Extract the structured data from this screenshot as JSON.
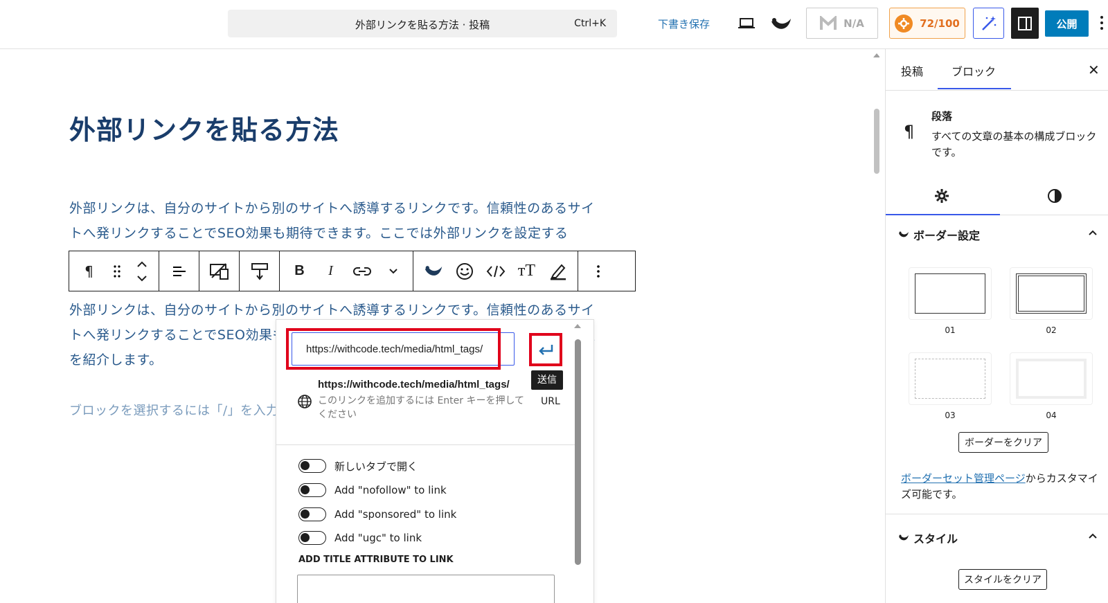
{
  "topbar": {
    "command_title": "外部リンクを貼る方法 · 投稿",
    "shortcut": "Ctrl+K",
    "save_draft": "下書き保存",
    "na_label": "N/A",
    "score": "72/100",
    "publish": "公開"
  },
  "editor": {
    "title": "外部リンクを貼る方法",
    "paragraph1": "外部リンクは、自分のサイトから別のサイトへ誘導するリンクです。信頼性のあるサイトへ発リンクすることでSEO効果も期待できます。ここでは外部リンクを設定する",
    "paragraph2": "外部リンクは、自分のサイトから別のサイトへ誘導するリンクです。信頼性のあるサイトへ発リンクすることでSEO効果も期待できます。ここでは外部リンクを設定する手順を紹介します。",
    "placeholder": "ブロックを選択するには「/」を入力"
  },
  "link_popover": {
    "url_value": "https://withcode.tech/media/html_tags/",
    "tooltip": "送信",
    "suggestion_url": "https://withcode.tech/media/html_tags/",
    "suggestion_hint": "このリンクを追加するには Enter キーを押してください",
    "suggestion_type": "URL",
    "toggles": [
      {
        "label": "新しいタブで開く"
      },
      {
        "label": "Add \"nofollow\" to link"
      },
      {
        "label": "Add \"sponsored\" to link"
      },
      {
        "label": "Add \"ugc\" to link"
      }
    ],
    "title_attr_label": "ADD TITLE ATTRIBUTE TO LINK"
  },
  "sidebar": {
    "tab_post": "投稿",
    "tab_block": "ブロック",
    "block_name": "段落",
    "block_desc": "すべての文章の基本の構成ブロックです。",
    "border_section": "ボーダー設定",
    "border_options": [
      "01",
      "02",
      "03",
      "04"
    ],
    "clear_border": "ボーダーをクリア",
    "border_link": "ボーダーセット管理ページ",
    "border_note_rest": "からカスタマイズ可能です。",
    "style_section": "スタイル",
    "clear_style": "スタイルをクリア"
  },
  "colors": {
    "accent": "#3858e9",
    "publish": "#007cba",
    "highlight": "#e0001b",
    "score": "#e26f1f"
  }
}
